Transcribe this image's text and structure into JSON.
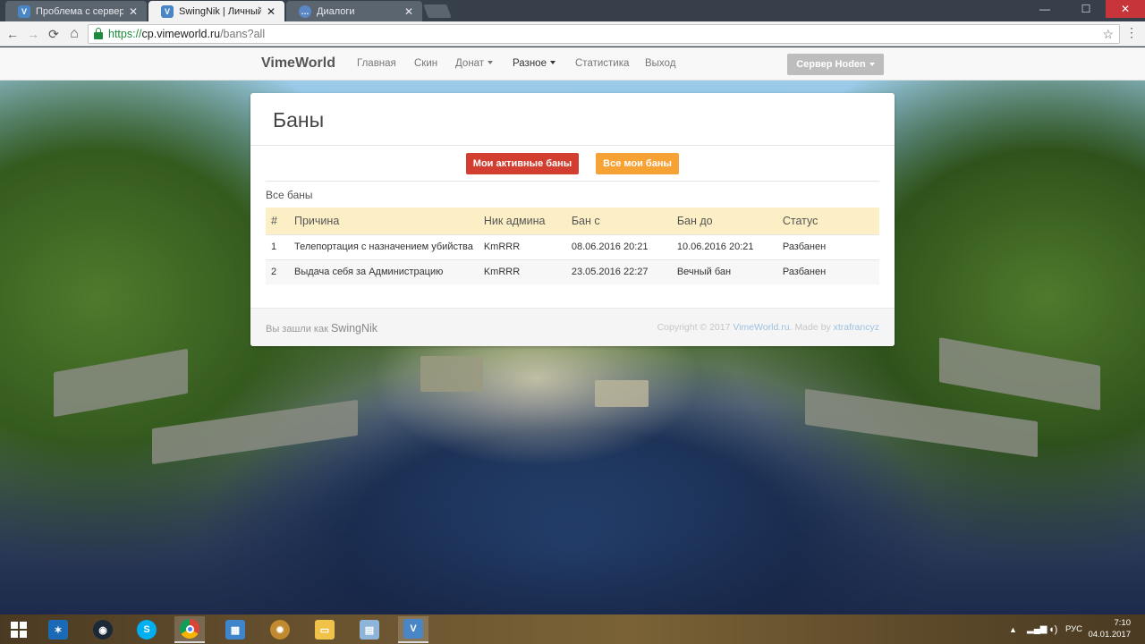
{
  "browser": {
    "tabs": [
      {
        "title": "Проблема с сервером",
        "icon": "vimeworld-icon"
      },
      {
        "title": "SwingNik | Личный каби",
        "icon": "vimeworld-icon"
      },
      {
        "title": "Диалоги",
        "icon": "chat-icon"
      }
    ],
    "tab_close_glyph": "✕",
    "url": {
      "scheme": "https://",
      "host": "cp.vimeworld.ru",
      "path": "/bans?all"
    },
    "nav": {
      "back": "←",
      "forward": "→",
      "reload": "⟳",
      "home": "⌂",
      "star": "☆",
      "menu": "⋮"
    },
    "window_controls": {
      "minimize": "—",
      "maximize": "☐",
      "close": "✕"
    }
  },
  "navbar": {
    "brand": "VimeWorld",
    "links": [
      "Главная",
      "Скин",
      "Донат",
      "Разное",
      "Статистика",
      "Выход"
    ],
    "server_button": "Сервер Hoden"
  },
  "panel": {
    "title": "Баны",
    "btn_active": "Мои активные баны",
    "btn_all": "Все мои баны",
    "section_label": "Все баны",
    "table": {
      "headers": [
        "#",
        "Причина",
        "Ник админа",
        "Бан с",
        "Бан до",
        "Статус"
      ],
      "rows": [
        {
          "num": "1",
          "reason": "Телепортация с назначением убийства",
          "admin": "KmRRR",
          "from": "08.06.2016 20:21",
          "to": "10.06.2016 20:21",
          "status": "Разбанен"
        },
        {
          "num": "2",
          "reason": "Выдача себя за Администрацию",
          "admin": "KmRRR",
          "from": "23.05.2016 22:27",
          "to": "Вечный бан",
          "status": "Разбанен"
        }
      ]
    },
    "footer": {
      "logged_prefix": "Вы зашли как",
      "username": "SwingNik",
      "copyright": "Copyright © 2017",
      "site_link": "VimeWorld.ru.",
      "made_by": "Made by",
      "author": "xtrafrancyz"
    }
  },
  "taskbar": {
    "apps": [
      "windows-start-icon",
      "battlenet-icon",
      "steam-icon",
      "skype-icon",
      "chrome-icon",
      "control-panel-icon",
      "hearthstone-icon",
      "file-explorer-icon",
      "photos-icon",
      "vimeworld-launcher-icon"
    ],
    "tray_lang": "РУС",
    "time": "7:10",
    "date": "04.01.2017"
  },
  "colors": {
    "accent_red": "#d23f31",
    "accent_orange": "#f7a234",
    "status_green": "#3fa33f",
    "perma_red": "#c0392b",
    "table_header": "#fcefc5"
  }
}
